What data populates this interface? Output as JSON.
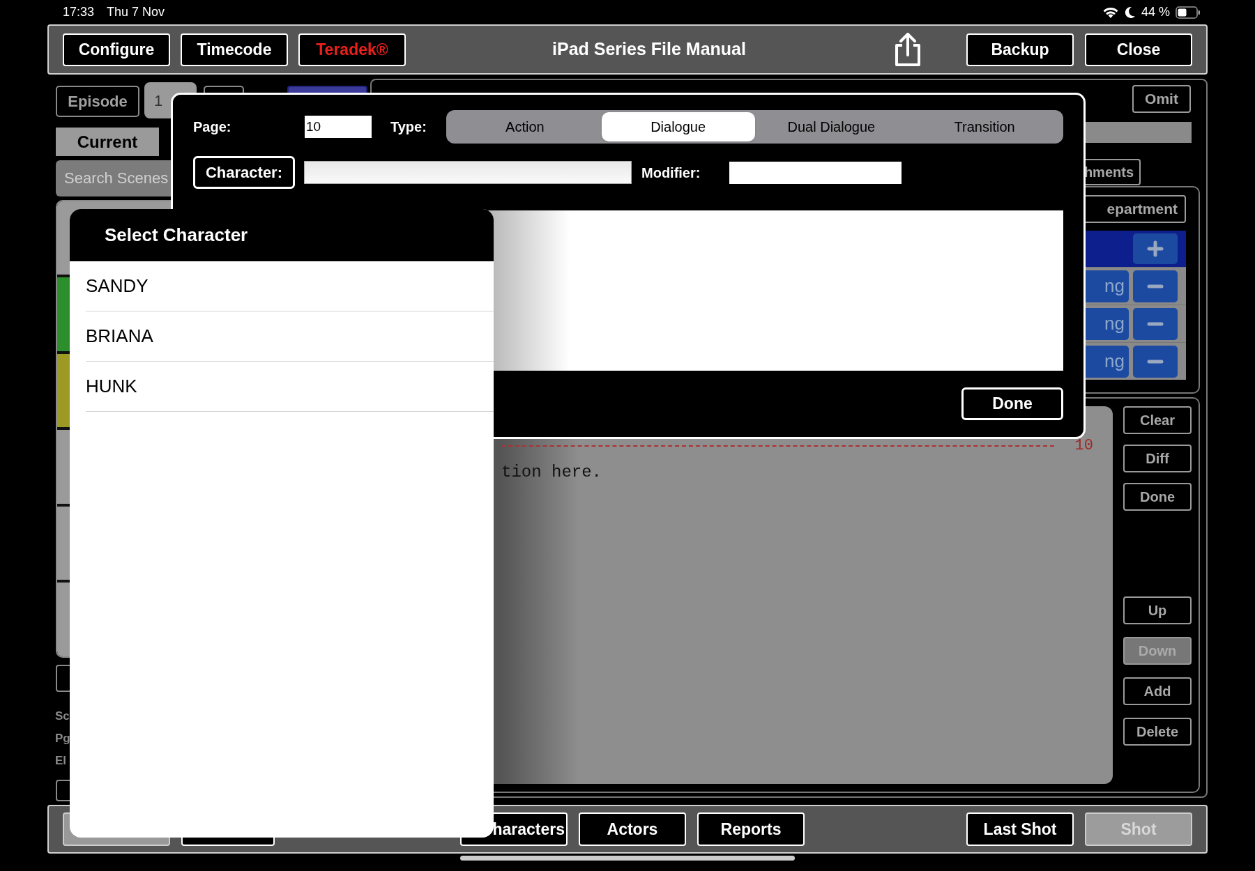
{
  "status_bar": {
    "time": "17:33",
    "date": "Thu 7 Nov",
    "battery": "44 %"
  },
  "toolbar": {
    "left_buttons": [
      {
        "label": "Configure",
        "kind": "plain"
      },
      {
        "label": "Timecode",
        "kind": "plain"
      },
      {
        "label": "Teradek®",
        "kind": "alert"
      }
    ],
    "title": "iPad Series File Manual",
    "right_buttons": [
      {
        "label": "Backup"
      },
      {
        "label": "Close"
      }
    ]
  },
  "sidebar": {
    "episode_button": "Episode",
    "episode_value": "1",
    "tabs": [
      {
        "label": "Current",
        "selected": true
      }
    ],
    "search": {
      "placeholder": "Search Scenes"
    },
    "scenes": [
      {
        "color": "#9a9a9a"
      },
      {
        "color": "#2c8f2c"
      },
      {
        "color": "#9c9a25"
      },
      {
        "color": "#9a9a9a"
      },
      {
        "color": "#9a9a9a"
      },
      {
        "color": "#9a9a9a"
      }
    ],
    "summary_labels": [
      "Sc",
      "Pg",
      "El"
    ]
  },
  "editor": {
    "omit_button": "Omit",
    "attachments_button": "hments",
    "department_button": "epartment",
    "department_rows": [
      "ng",
      "ng",
      "ng"
    ],
    "page_number": "10",
    "script_line": "tion here.",
    "side_buttons_top": [
      {
        "label": "Clear",
        "disabled": false
      },
      {
        "label": "Diff",
        "disabled": false
      },
      {
        "label": "Done",
        "disabled": false
      }
    ],
    "side_buttons_bottom": [
      {
        "label": "Up",
        "disabled": false
      },
      {
        "label": "Down",
        "disabled": true
      },
      {
        "label": "Add",
        "disabled": false
      },
      {
        "label": "Delete",
        "disabled": false
      }
    ]
  },
  "bottom_bar": {
    "left_buttons": [
      {
        "label": "haracters",
        "disabled": false
      },
      {
        "label": "Actors",
        "disabled": false
      },
      {
        "label": "Reports",
        "disabled": false
      }
    ],
    "right_buttons": [
      {
        "label": "Last Shot",
        "disabled": false
      },
      {
        "label": "Shot",
        "disabled": true
      }
    ]
  },
  "dialog": {
    "page_label": "Page:",
    "page_value": "10",
    "type_label": "Type:",
    "types": [
      {
        "label": "Action",
        "selected": false
      },
      {
        "label": "Dialogue",
        "selected": true
      },
      {
        "label": "Dual Dialogue",
        "selected": false
      },
      {
        "label": "Transition",
        "selected": false
      }
    ],
    "character_button": "Character:",
    "modifier_label": "Modifier:",
    "done_button": "Done"
  },
  "character_picker": {
    "title": "Select Character",
    "items": [
      {
        "label": "SANDY"
      },
      {
        "label": "BRIANA"
      },
      {
        "label": "HUNK"
      }
    ]
  }
}
